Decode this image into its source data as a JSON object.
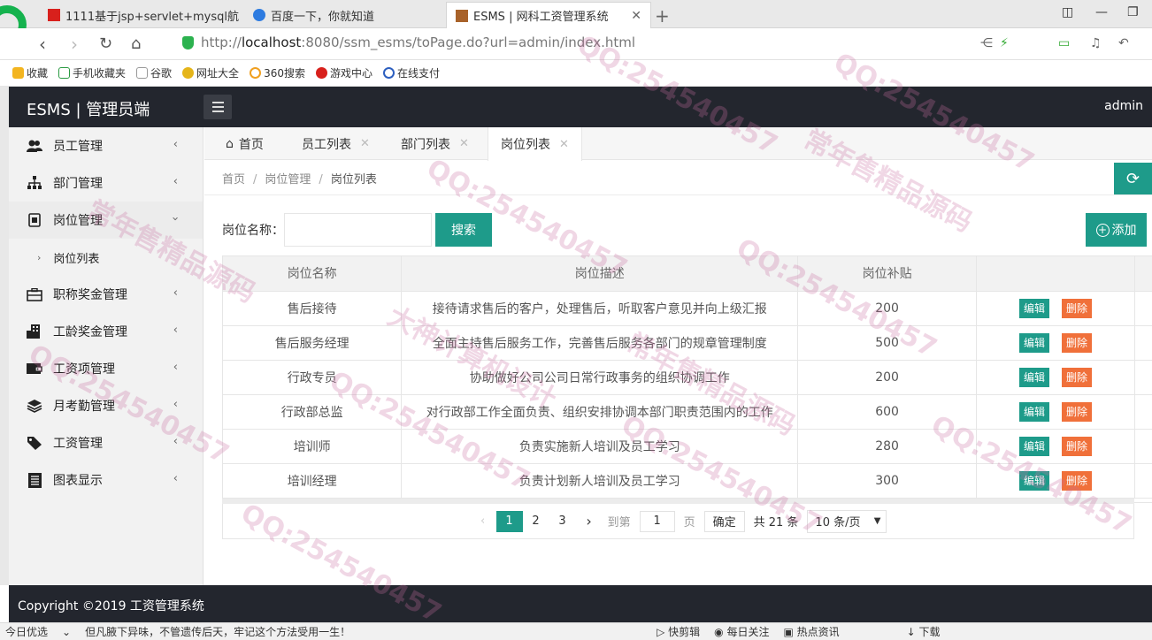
{
  "browser": {
    "tabs": [
      {
        "title": "1111基于jsp+servlet+mysql航"
      },
      {
        "title": "百度一下，你就知道"
      },
      {
        "title": "ESMS | 网科工资管理系统"
      }
    ],
    "url_prefix": "http://",
    "url_host": "localhost",
    "url_rest": ":8080/ssm_esms/toPage.do?url=admin/index.html",
    "bookmarks": [
      "收藏",
      "手机收藏夹",
      "谷歌",
      "网址大全",
      "360搜索",
      "游戏中心",
      "在线支付"
    ]
  },
  "app": {
    "title": "ESMS | 管理员端",
    "user": "admin",
    "footer": "Copyright ©2019 工资管理系统"
  },
  "sidebar": {
    "items": [
      {
        "label": "员工管理",
        "icon": "users-icon"
      },
      {
        "label": "部门管理",
        "icon": "sitemap-icon"
      },
      {
        "label": "岗位管理",
        "icon": "badge-icon",
        "open": true,
        "children": [
          {
            "label": "岗位列表"
          }
        ]
      },
      {
        "label": "职称奖金管理",
        "icon": "briefcase-icon"
      },
      {
        "label": "工龄奖金管理",
        "icon": "building-icon"
      },
      {
        "label": "工资项管理",
        "icon": "wallet-icon"
      },
      {
        "label": "月考勤管理",
        "icon": "layers-icon"
      },
      {
        "label": "工资管理",
        "icon": "tag-icon"
      },
      {
        "label": "图表显示",
        "icon": "book-icon"
      }
    ]
  },
  "page_tabs": [
    {
      "label": "首页"
    },
    {
      "label": "员工列表"
    },
    {
      "label": "部门列表"
    },
    {
      "label": "岗位列表"
    }
  ],
  "breadcrumb": {
    "home": "首页",
    "parent": "岗位管理",
    "current": "岗位列表",
    "sep": "/"
  },
  "search": {
    "label": "岗位名称：",
    "value": "",
    "button": "搜索"
  },
  "add_button": "添加",
  "table": {
    "headers": [
      "岗位名称",
      "岗位描述",
      "岗位补贴",
      ""
    ],
    "rows": [
      {
        "name": "售后接待",
        "desc": "接待请求售后的客户，处理售后，听取客户意见并向上级汇报",
        "subsidy": "200"
      },
      {
        "name": "售后服务经理",
        "desc": "全面主持售后服务工作，完善售后服务各部门的规章管理制度",
        "subsidy": "500"
      },
      {
        "name": "行政专员",
        "desc": "协助做好公司公司日常行政事务的组织协调工作",
        "subsidy": "200"
      },
      {
        "name": "行政部总监",
        "desc": "对行政部工作全面负责、组织安排协调本部门职责范围内的工作",
        "subsidy": "600"
      },
      {
        "name": "培训师",
        "desc": "负责实施新人培训及员工学习",
        "subsidy": "280"
      },
      {
        "name": "培训经理",
        "desc": "负责计划新人培训及员工学习",
        "subsidy": "300"
      }
    ],
    "edit_label": "编辑",
    "delete_label": "删除"
  },
  "pagination": {
    "pages": [
      "1",
      "2",
      "3"
    ],
    "current": "1",
    "goto_label": "到第",
    "goto_value": "1",
    "page_unit": "页",
    "ok": "确定",
    "total": "共 21 条",
    "page_size": "10 条/页"
  },
  "statusbar": {
    "left": "今日优选",
    "news": "但凡腋下异味，不管遗传后天，牢记这个方法受用一生！",
    "items": [
      "快剪辑",
      "每日关注",
      "热点资讯",
      "下载"
    ]
  },
  "watermarks": [
    "QQ:254540457",
    "大神计算机设计",
    "常年售精品源码"
  ]
}
